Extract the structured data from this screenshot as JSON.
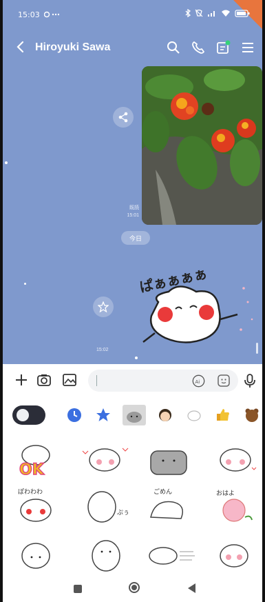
{
  "statusbar": {
    "time": "15:03"
  },
  "header": {
    "title": "Hiroyuki Sawa"
  },
  "chat": {
    "read_label": "既読",
    "time1": "15:01",
    "date_pill": "今日",
    "time2": "15:02",
    "sticker_text": "ぱぁぁぁぁ"
  },
  "input": {
    "placeholder": "",
    "value": "",
    "ai_label": "Ai"
  },
  "sticker_cells": [
    {
      "text": "OK"
    },
    {
      "text": ""
    },
    {
      "text": ""
    },
    {
      "text": ""
    },
    {
      "text": "ぽわわわ"
    },
    {
      "text": "ぷぅ"
    },
    {
      "text": "ごめん"
    },
    {
      "text": "おはよ"
    },
    {
      "text": ""
    },
    {
      "text": ""
    },
    {
      "text": ""
    },
    {
      "text": ""
    }
  ],
  "colors": {
    "chat_bg": "#7f99cd",
    "accent_blue": "#3b6fe0",
    "toggle_bg": "#2b2d38"
  }
}
